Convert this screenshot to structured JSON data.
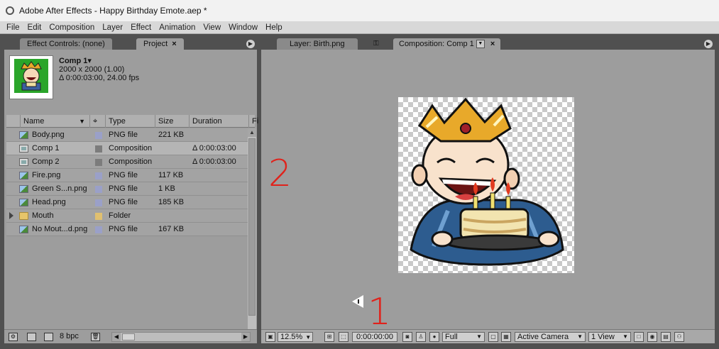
{
  "window": {
    "title": "Adobe After Effects - Happy Birthday Emote.aep *"
  },
  "menu": [
    "File",
    "Edit",
    "Composition",
    "Layer",
    "Effect",
    "Animation",
    "View",
    "Window",
    "Help"
  ],
  "left_panel": {
    "tabs": [
      {
        "label": "Effect Controls: (none)"
      },
      {
        "label": "Project",
        "close": "×"
      }
    ],
    "comp_info": {
      "name": "Comp 1▾",
      "size": "2000 x 2000 (1.00)",
      "duration": "Δ 0:00:03:00, 24.00 fps"
    },
    "columns": [
      "Name",
      "Type",
      "Size",
      "Duration",
      "Fi"
    ],
    "items": [
      {
        "name": "Body.png",
        "kind": "png",
        "type": "PNG file",
        "size": "221 KB",
        "duration": "",
        "label_color": "#9aa0c8"
      },
      {
        "name": "Comp 1",
        "kind": "comp",
        "type": "Composition",
        "size": "",
        "duration": "Δ 0:00:03:00",
        "label_color": "#7c7c7c",
        "selected": true
      },
      {
        "name": "Comp 2",
        "kind": "comp",
        "type": "Composition",
        "size": "",
        "duration": "Δ 0:00:03:00",
        "label_color": "#7c7c7c"
      },
      {
        "name": "Fire.png",
        "kind": "png",
        "type": "PNG file",
        "size": "117 KB",
        "duration": "",
        "label_color": "#9aa0c8"
      },
      {
        "name": "Green S...n.png",
        "kind": "png",
        "type": "PNG file",
        "size": "1 KB",
        "duration": "",
        "label_color": "#9aa0c8"
      },
      {
        "name": "Head.png",
        "kind": "png",
        "type": "PNG file",
        "size": "185 KB",
        "duration": "",
        "label_color": "#9aa0c8"
      },
      {
        "name": "Mouth",
        "kind": "folder",
        "type": "Folder",
        "size": "",
        "duration": "",
        "label_color": "#e0c070"
      },
      {
        "name": "No Mout...d.png",
        "kind": "png",
        "type": "PNG file",
        "size": "167 KB",
        "duration": "",
        "label_color": "#9aa0c8"
      }
    ],
    "bit_depth": "8 bpc"
  },
  "right_panel": {
    "tabs": [
      {
        "label": "Layer: Birth.png"
      },
      {
        "label": "Composition: Comp 1",
        "close": "×"
      }
    ],
    "annotations": {
      "one": "1",
      "two": "2"
    },
    "viewer_bar": {
      "zoom": "12.5%",
      "timecode": "0:00:00:00",
      "resolution": "Full",
      "camera": "Active Camera",
      "views": "1 View"
    }
  },
  "colors": {
    "panel": "#9d9d9d",
    "background": "#505050",
    "annotation": "#e0221b"
  }
}
